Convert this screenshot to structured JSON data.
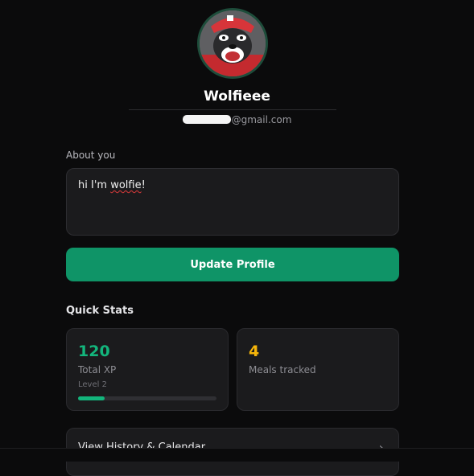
{
  "profile": {
    "display_name": "Wolfieee",
    "email_suffix": "@gmail.com"
  },
  "about": {
    "label": "About you",
    "text_before": "hi I'm ",
    "text_flagged": "wolfie",
    "text_after": "!"
  },
  "actions": {
    "update_label": "Update Profile"
  },
  "quick_stats": {
    "title": "Quick Stats",
    "xp": {
      "value": "120",
      "label": "Total XP",
      "level": "Level 2",
      "level_progress": 0.19
    },
    "meals": {
      "value": "4",
      "label": "Meals tracked"
    }
  },
  "history": {
    "label": "View History & Calendar",
    "chevron_icon": "chevron-right-icon"
  },
  "colors": {
    "accent_green": "#0f9467",
    "xp_green": "#13b57c",
    "meals_amber": "#f5b50a",
    "background": "#0b0b0c"
  }
}
